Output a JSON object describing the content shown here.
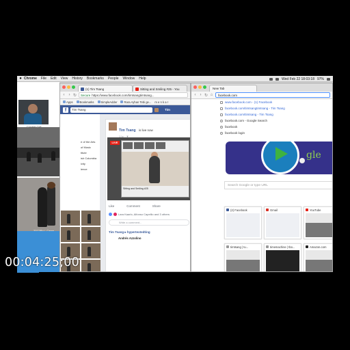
{
  "menubar": {
    "items": [
      "Chrome",
      "File",
      "Edit",
      "View",
      "History",
      "Bookmarks",
      "People",
      "Window",
      "Help"
    ],
    "clock": "Wed Feb 22  18:03:18",
    "battery": "97%"
  },
  "left": {
    "cam_label": "Current Cell",
    "nav": [
      "e of the Arts",
      "of Music",
      "titute",
      "ish Columbia",
      "ivity",
      "ience"
    ],
    "dancers_label": "2017/Bu-i, Camp..."
  },
  "fb_window": {
    "tabs": [
      {
        "label": "(1) Tim Tsang",
        "icon": "facebook-favicon"
      },
      {
        "label": "Sitting and Smiling #25 - You",
        "icon": "youtube-favicon"
      }
    ],
    "secure": "Secure",
    "url": "https://www.facebook.com/timtsangtimtsang...",
    "bookmarks": [
      "Apps",
      "Bookmarks",
      "SimpleAdder",
      "Rara Ayhan Tebi ge...",
      "m e n k a r"
    ],
    "search_value": "Tim Tsang",
    "user": "Tim",
    "post_author": "Tim Tsang",
    "post_status": "is live now",
    "post_time": "1 hr · ▼",
    "live_badge": "LIVE",
    "inner_caption": "Sitting and Smiling #25",
    "actions": [
      "Like",
      "Comment",
      "Share"
    ],
    "reactions": "Lara Kaarlo, Alfonso Capellio and 3 others",
    "comment_placeholder": "Write a comment...",
    "post2": "Tim Tsang ▸ hypertextedting",
    "post3": "Andrés Azzolino"
  },
  "nt_window": {
    "tab": "New Tab",
    "omnibox": "facebook.com",
    "suggestions": [
      {
        "text": "www.facebook.com - (1) Facebook",
        "type": "page"
      },
      {
        "text": "facebook.com/timtsangtimtsang - Tim Tsang",
        "type": "page"
      },
      {
        "text": "facebook.com/timtsang - Tim Tsang",
        "type": "page"
      },
      {
        "text": "facebook.com - Google Search",
        "type": "query"
      },
      {
        "text": "facebook",
        "type": "query"
      },
      {
        "text": "facebook login",
        "type": "query"
      }
    ],
    "doodle_text": "gle",
    "search_placeholder": "Search Google or type URL",
    "tiles": [
      {
        "label": "(2) Facebook",
        "style": "light"
      },
      {
        "label": "Gmail",
        "style": "light"
      },
      {
        "label": "YouTube",
        "style": "light"
      },
      {
        "label": "timtsang | tu...",
        "style": "light"
      },
      {
        "label": "timemachine | tbo...",
        "style": "dark"
      },
      {
        "label": "Amazon.com",
        "style": "mixed"
      }
    ]
  },
  "timecode": "00:04:25;00",
  "colors": {
    "facebook_blue": "#3b5998",
    "live_red": "#e62117",
    "chrome_blue": "#4d90fe"
  }
}
